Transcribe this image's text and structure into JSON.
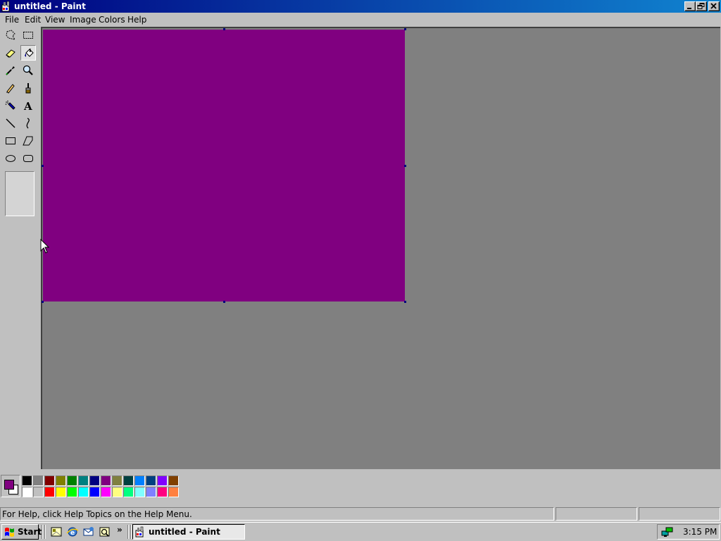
{
  "window": {
    "title": "untitled - Paint",
    "controls": [
      "minimize",
      "restore",
      "close"
    ]
  },
  "menu": {
    "items": [
      "File",
      "Edit",
      "View",
      "Image",
      "Colors",
      "Help"
    ]
  },
  "toolbox": {
    "tools": [
      {
        "name": "free-form-select",
        "icon": "freeform-select-icon"
      },
      {
        "name": "select",
        "icon": "rect-select-icon"
      },
      {
        "name": "eraser",
        "icon": "eraser-icon"
      },
      {
        "name": "fill-with-color",
        "icon": "paint-bucket-icon",
        "active": true
      },
      {
        "name": "pick-color",
        "icon": "eyedropper-icon"
      },
      {
        "name": "magnifier",
        "icon": "magnifier-icon"
      },
      {
        "name": "pencil",
        "icon": "pencil-icon"
      },
      {
        "name": "brush",
        "icon": "brush-icon"
      },
      {
        "name": "airbrush",
        "icon": "airbrush-icon"
      },
      {
        "name": "text",
        "icon": "text-icon",
        "glyph": "A"
      },
      {
        "name": "line",
        "icon": "line-icon"
      },
      {
        "name": "curve",
        "icon": "curve-icon"
      },
      {
        "name": "rectangle",
        "icon": "rectangle-icon"
      },
      {
        "name": "polygon",
        "icon": "polygon-icon"
      },
      {
        "name": "ellipse",
        "icon": "ellipse-icon"
      },
      {
        "name": "rounded-rectangle",
        "icon": "rounded-rect-icon"
      }
    ]
  },
  "canvas": {
    "fill_color": "#800080"
  },
  "colors": {
    "foreground": "#800080",
    "background": "#ffffff",
    "palette_top": [
      "#000000",
      "#808080",
      "#800000",
      "#808000",
      "#008000",
      "#008080",
      "#000080",
      "#800080",
      "#808040",
      "#004040",
      "#0080ff",
      "#004080",
      "#8000ff",
      "#804000"
    ],
    "palette_bottom": [
      "#ffffff",
      "#c0c0c0",
      "#ff0000",
      "#ffff00",
      "#00ff00",
      "#00ffff",
      "#0000ff",
      "#ff00ff",
      "#ffff80",
      "#00ff80",
      "#80ffff",
      "#8080ff",
      "#ff0080",
      "#ff8040"
    ]
  },
  "status": {
    "help_text": "For Help, click Help Topics on the Help Menu."
  },
  "taskbar": {
    "start_label": "Start",
    "quick_launch": [
      "show-desktop-icon",
      "internet-explorer-icon",
      "outlook-express-icon",
      "channels-icon"
    ],
    "overflow": "»",
    "tasks": [
      {
        "label": "untitled - Paint",
        "icon": "paint-app-icon",
        "active": true
      }
    ],
    "tray_icon": "network-icon",
    "clock": "3:15 PM"
  },
  "theme": {
    "titlebar_start": "#000080",
    "titlebar_end": "#1084d0",
    "face": "#c0c0c0",
    "workspace": "#808080"
  }
}
